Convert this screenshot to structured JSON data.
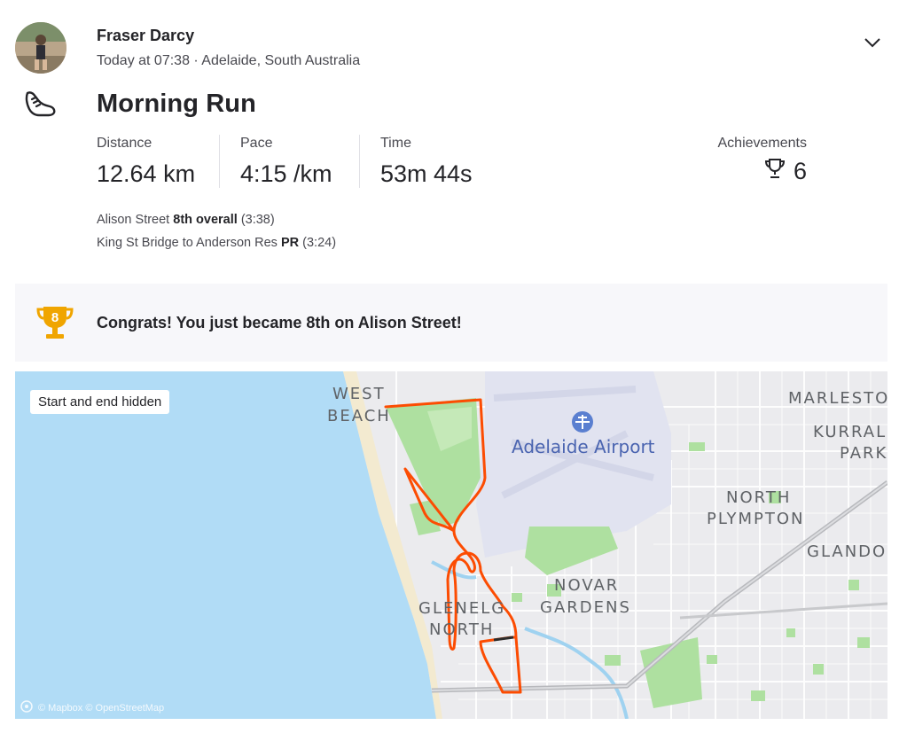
{
  "athlete": {
    "name": "Fraser Darcy",
    "meta": "Today at 07:38 · Adelaide, South Australia"
  },
  "activity": {
    "title": "Morning Run",
    "sport_icon": "shoe-icon"
  },
  "stats": [
    {
      "label": "Distance",
      "value": "12.64 km"
    },
    {
      "label": "Pace",
      "value": "4:15 /km"
    },
    {
      "label": "Time",
      "value": "53m 44s"
    }
  ],
  "achievements": {
    "label": "Achievements",
    "count": "6",
    "icon": "trophy-icon"
  },
  "segments": [
    {
      "name": "Alison Street",
      "rank": "8th overall",
      "time": "(3:38)"
    },
    {
      "name": "King St Bridge to Anderson Res",
      "rank": "PR",
      "time": "(3:24)"
    }
  ],
  "congrats": {
    "medal_number": "8",
    "text": "Congrats! You just became 8th on Alison Street!",
    "medal_color": "#f0a500"
  },
  "map": {
    "badge": "Start and end hidden",
    "attribution": "© Mapbox © OpenStreetMap",
    "airport": "Adelaide Airport",
    "labels": {
      "west": "WEST",
      "beach": "BEACH",
      "marlesto": "MARLESTO",
      "kurrali": "KURRALI",
      "park": "PARK",
      "north": "NORTH",
      "plympton": "PLYMPTON",
      "glando": "GLANDO",
      "novar": "NOVAR",
      "gardens": "GARDENS",
      "glenelg": "GLENELG",
      "glenelg_north": "NORTH"
    },
    "route_color": "#fc4c02",
    "water_color": "#b1dcf6",
    "park_color": "#aee0a0"
  }
}
